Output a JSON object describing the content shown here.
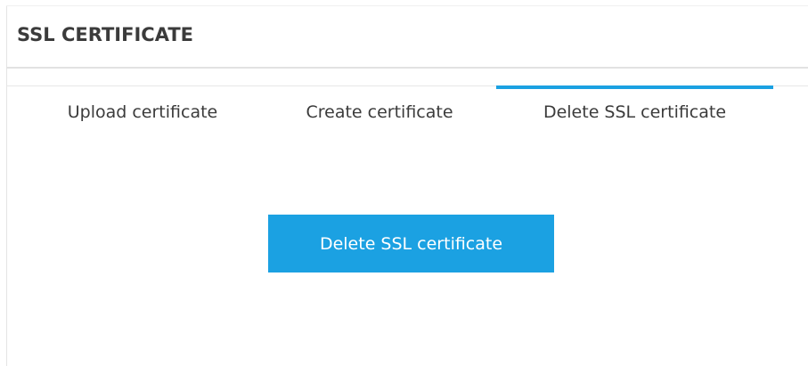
{
  "panel": {
    "title": "SSL CERTIFICATE"
  },
  "tabs": [
    {
      "label": "Upload certificate",
      "active": false
    },
    {
      "label": "Create certificate",
      "active": false
    },
    {
      "label": "Delete SSL certificate",
      "active": true
    }
  ],
  "main": {
    "delete_button_label": "Delete SSL certificate"
  },
  "colors": {
    "accent": "#1ba1e2",
    "text": "#3b3b3b",
    "divider": "#e2e2e2"
  }
}
